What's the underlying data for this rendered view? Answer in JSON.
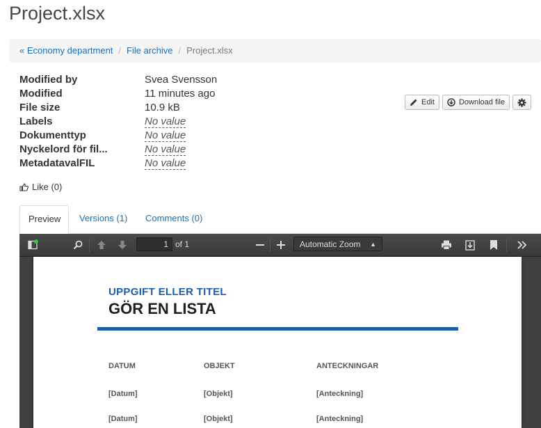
{
  "page": {
    "title": "Project.xlsx"
  },
  "breadcrumb": {
    "items": [
      "« Economy department",
      "File archive"
    ],
    "current": "Project.xlsx"
  },
  "metadata": [
    {
      "key": "Modified by",
      "value": "Svea Svensson",
      "empty": false
    },
    {
      "key": "Modified",
      "value": "11 minutes ago",
      "empty": false
    },
    {
      "key": "File size",
      "value": "10.9 kB",
      "empty": false
    },
    {
      "key": "Labels",
      "value": "No value",
      "empty": true
    },
    {
      "key": "Dokumenttyp",
      "value": "No value",
      "empty": true
    },
    {
      "key": "Nyckelord för fil...",
      "value": "No value",
      "empty": true
    },
    {
      "key": "MetadatavalFIL",
      "value": "No value",
      "empty": true
    }
  ],
  "actions": {
    "edit": "Edit",
    "download": "Download file"
  },
  "like": {
    "label": "Like (0)"
  },
  "tabs": [
    {
      "label": "Preview",
      "active": true
    },
    {
      "label": "Versions (1)",
      "active": false
    },
    {
      "label": "Comments (0)",
      "active": false
    }
  ],
  "viewer": {
    "page_number": "1",
    "of_label": "of 1",
    "zoom": "Automatic Zoom"
  },
  "document": {
    "subtitle": "UPPGIFT ELLER TITEL",
    "title": "GÖR EN LISTA",
    "columns": [
      "DATUM",
      "OBJEKT",
      "ANTECKNINGAR"
    ],
    "rows": [
      [
        "[Datum]",
        "[Objekt]",
        "[Anteckning]"
      ],
      [
        "[Datum]",
        "[Objekt]",
        "[Anteckning]"
      ]
    ]
  },
  "colors": {
    "link": "#1a6fb5",
    "accent": "#1a5ea8",
    "status_dot": "#2ecc40"
  }
}
